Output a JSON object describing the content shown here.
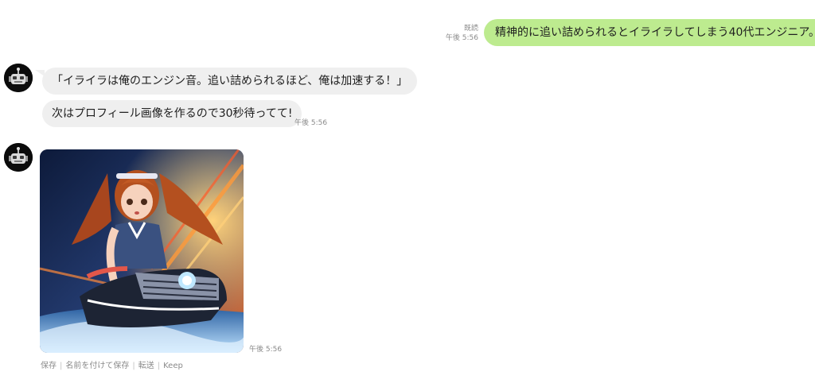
{
  "outgoing": {
    "read_label": "既読",
    "time": "午後 5:56",
    "text": "精神的に追い詰められるとイライラしてしまう40代エンジニア。"
  },
  "incoming": {
    "message1": "「イライラは俺のエンジン音。追い詰められるほど、俺は加速する！」",
    "message2": "次はプロフィール画像を作るので30秒待ってて!",
    "message2_time": "午後 5:56",
    "image_time": "午後 5:56"
  },
  "image_actions": {
    "save": "保存",
    "save_as": "名前を付けて保存",
    "forward": "転送",
    "keep": "Keep",
    "separator": "|"
  },
  "icons": {
    "avatar": "robot-avatar-icon"
  },
  "colors": {
    "outgoing_bubble": "#bdeb8f",
    "incoming_bubble": "#efefef",
    "meta_text": "#8a8a8a"
  }
}
